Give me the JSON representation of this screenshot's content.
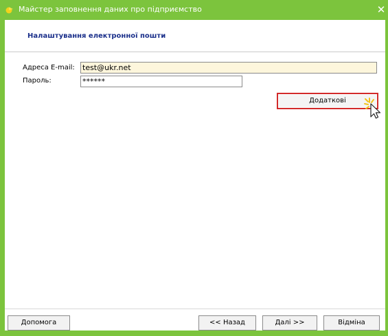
{
  "window": {
    "title": "Майстер заповнення даних про підприємство",
    "close_label": "✕"
  },
  "section": {
    "title": "Налаштування електронної пошти"
  },
  "form": {
    "email_label": "Адреса E-mail:",
    "email_value": "test@ukr.net",
    "password_label": "Пароль:",
    "password_value": "******"
  },
  "buttons": {
    "advanced": "Додаткові",
    "help": "Допомога",
    "back": "<< Назад",
    "next": "Далі >>",
    "cancel": "Відміна"
  },
  "colors": {
    "titlebar": "#7cc43d",
    "accent_title": "#1a2f8a",
    "email_bg": "#fdf6dc",
    "highlight_border": "#d22a2a"
  },
  "icons": {
    "app": "app-icon",
    "cursor": "mouse-pointer-icon"
  }
}
